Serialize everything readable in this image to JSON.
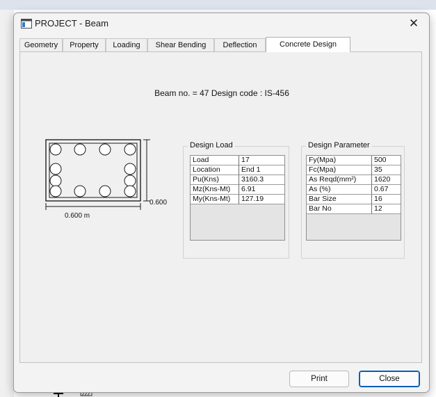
{
  "window": {
    "title": "PROJECT - Beam",
    "close_glyph": "✕",
    "icon": "window-app-icon"
  },
  "tabs": [
    {
      "label": "Geometry",
      "active": false
    },
    {
      "label": "Property",
      "active": false
    },
    {
      "label": "Loading",
      "active": false
    },
    {
      "label": "Shear Bending",
      "active": false
    },
    {
      "label": "Deflection",
      "active": false
    },
    {
      "label": "Concrete Design",
      "active": true
    }
  ],
  "beam_info": "Beam no. = 47  Design code :  IS-456",
  "section": {
    "height_label": "0.600",
    "width_label": "0.600 m",
    "bars_per_side": 4
  },
  "design_load": {
    "title": "Design Load",
    "rows": [
      {
        "key": "Load",
        "value": "17"
      },
      {
        "key": "Location",
        "value": "End 1"
      },
      {
        "key": "Pu(Kns)",
        "value": "3160.3"
      },
      {
        "key": "Mz(Kns-Mt)",
        "value": "6.91"
      },
      {
        "key": "My(Kns-Mt)",
        "value": "127.19"
      }
    ]
  },
  "design_parameter": {
    "title": "Design Parameter",
    "rows": [
      {
        "key": "Fy(Mpa)",
        "value": "500"
      },
      {
        "key": "Fc(Mpa)",
        "value": "35"
      },
      {
        "key": "As Reqd(mm²)",
        "value": "1620"
      },
      {
        "key": "As (%)",
        "value": "0.67"
      },
      {
        "key": "Bar Size",
        "value": "16"
      },
      {
        "key": "Bar No",
        "value": "12"
      }
    ]
  },
  "buttons": {
    "print": "Print",
    "close": "Close"
  },
  "colors": {
    "accent": "#005fb8"
  }
}
